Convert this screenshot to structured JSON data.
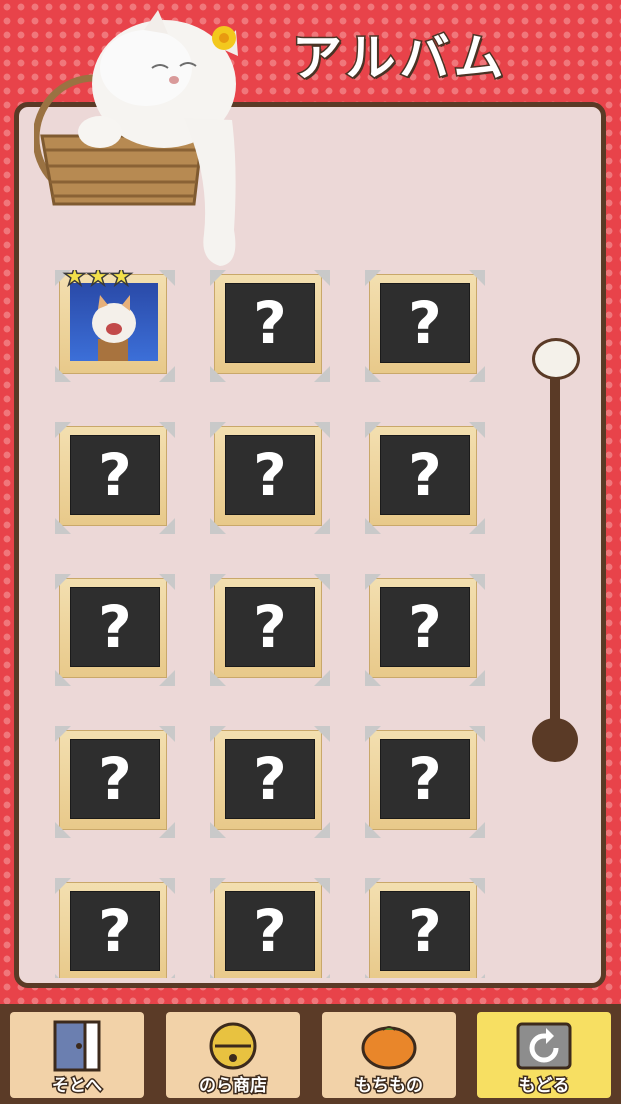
{
  "title": "アルバム",
  "album": {
    "tiles": [
      {
        "state": "unlocked",
        "stars": 3
      },
      {
        "state": "locked",
        "mark": "?"
      },
      {
        "state": "locked",
        "mark": "?"
      },
      {
        "state": "locked",
        "mark": "?"
      },
      {
        "state": "locked",
        "mark": "?"
      },
      {
        "state": "locked",
        "mark": "?"
      },
      {
        "state": "locked",
        "mark": "?"
      },
      {
        "state": "locked",
        "mark": "?"
      },
      {
        "state": "locked",
        "mark": "?"
      },
      {
        "state": "locked",
        "mark": "?"
      },
      {
        "state": "locked",
        "mark": "?"
      },
      {
        "state": "locked",
        "mark": "?"
      },
      {
        "state": "locked",
        "mark": "?"
      },
      {
        "state": "locked",
        "mark": "?"
      },
      {
        "state": "locked",
        "mark": "?"
      }
    ]
  },
  "nav": {
    "outside": "そとへ",
    "shop": "のら商店",
    "items": "もちもの",
    "back": "もどる"
  },
  "icons": {
    "outside": "door-icon",
    "shop": "bell-icon",
    "items": "orange-icon",
    "back": "return-arrow-icon"
  },
  "colors": {
    "background": "#e8434a",
    "panel": "#ecd8d7",
    "border": "#5a3a26",
    "active_button": "#f7df62"
  }
}
